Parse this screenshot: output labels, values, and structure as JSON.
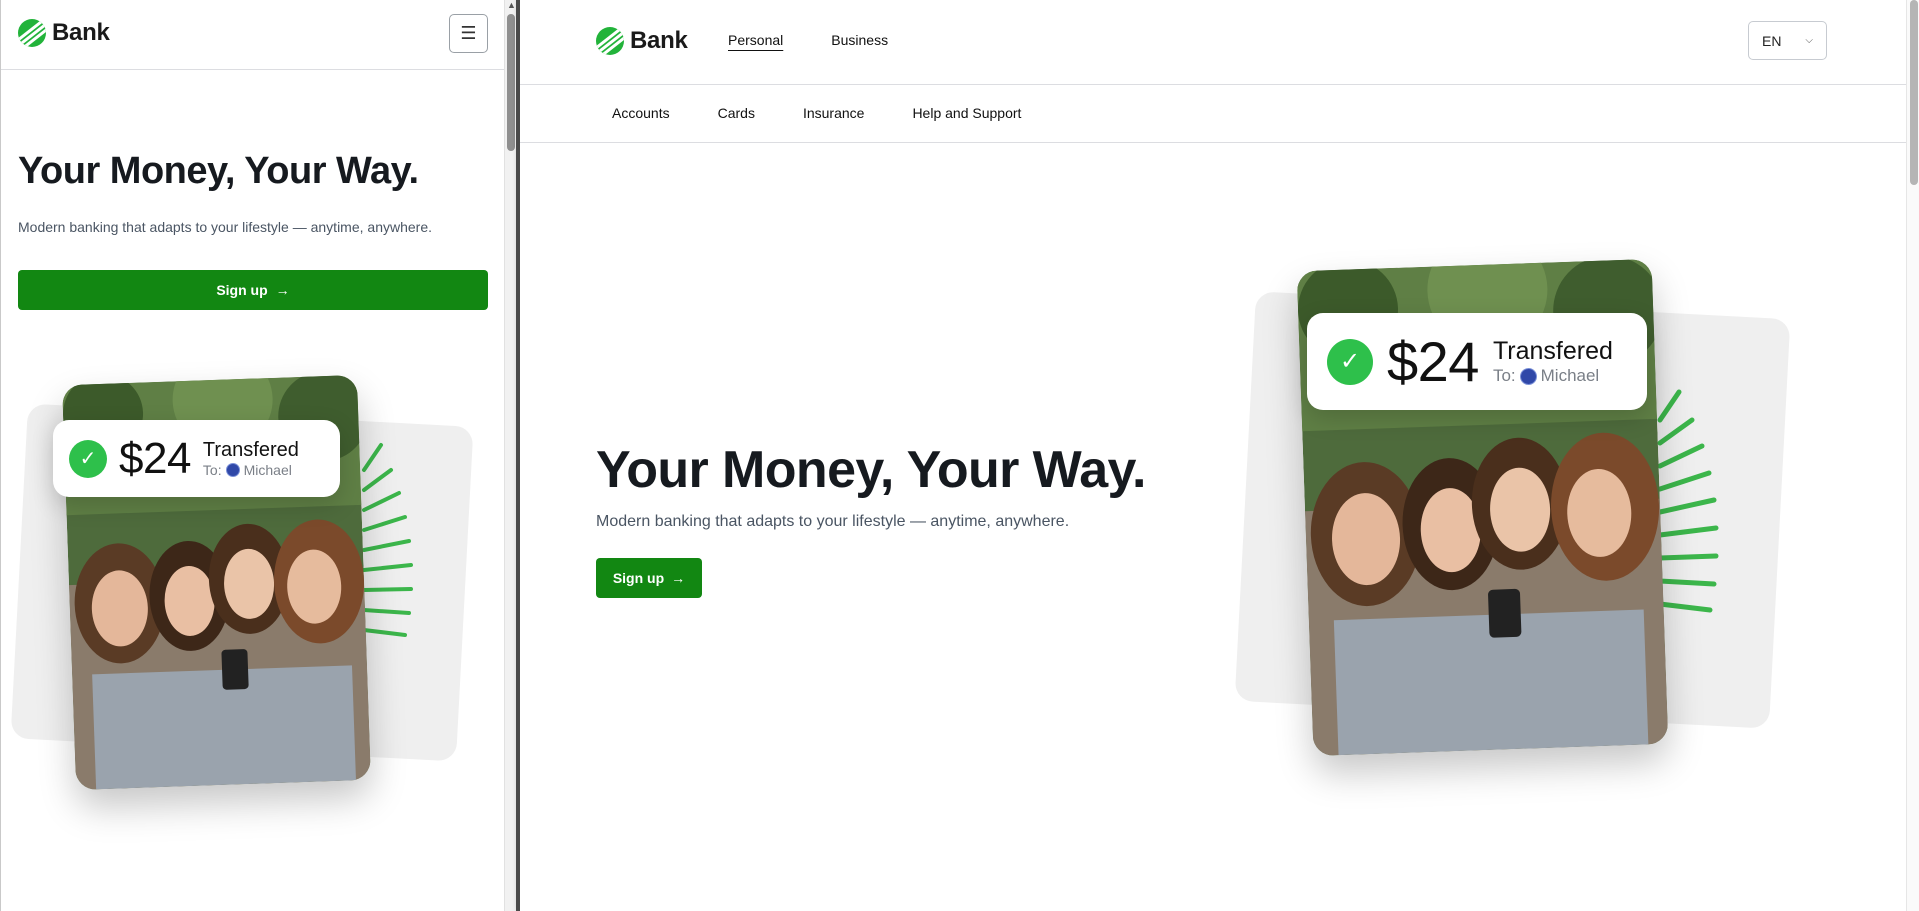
{
  "brand": {
    "name": "Bank",
    "accent_color": "#128712",
    "logo_color": "#22b33a"
  },
  "mobile": {
    "menu_icon": "hamburger-icon",
    "hero": {
      "title": "Your Money, Your Way.",
      "subtitle": "Modern banking that adapts to your lifestyle — anytime, anywhere.",
      "cta_label": "Sign up",
      "cta_arrow": "→"
    },
    "card": {
      "amount": "$24",
      "status": "Transfered",
      "to_label": "To:",
      "recipient": "Michael"
    }
  },
  "desktop": {
    "nav": {
      "items": [
        "Personal",
        "Business"
      ],
      "active": "Personal"
    },
    "language": {
      "value": "EN",
      "chevron": "⌄"
    },
    "subnav": {
      "items": [
        "Accounts",
        "Cards",
        "Insurance",
        "Help and Support"
      ]
    },
    "hero": {
      "title": "Your Money, Your Way.",
      "subtitle": "Modern banking that adapts to your lifestyle — anytime, anywhere.",
      "cta_label": "Sign up",
      "cta_arrow": "→"
    },
    "card": {
      "amount": "$24",
      "status": "Transfered",
      "to_label": "To:",
      "recipient": "Michael"
    }
  }
}
